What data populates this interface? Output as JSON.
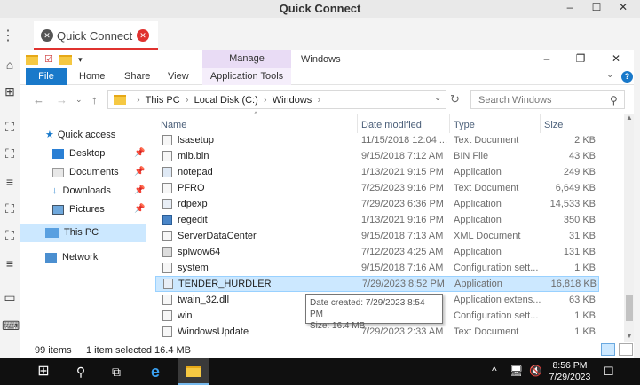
{
  "app": {
    "title": "Quick Connect",
    "tab_label": "Quick Connect",
    "window_controls": [
      "–",
      "☐",
      "✕"
    ]
  },
  "explorer": {
    "window_title": "Windows",
    "context_tab": "Manage",
    "context_subtab": "Application Tools",
    "ribbon_tabs": [
      "File",
      "Home",
      "Share",
      "View"
    ],
    "address_parts": [
      "This PC",
      "Local Disk (C:)",
      "Windows"
    ],
    "search_placeholder": "Search Windows",
    "nav_pane": {
      "quick_access": "Quick access",
      "items": [
        {
          "label": "Desktop",
          "pinned": true
        },
        {
          "label": "Documents",
          "pinned": true
        },
        {
          "label": "Downloads",
          "pinned": true
        },
        {
          "label": "Pictures",
          "pinned": true
        }
      ],
      "this_pc": "This PC",
      "network": "Network"
    },
    "columns": {
      "name": "Name",
      "date": "Date modified",
      "type": "Type",
      "size": "Size"
    },
    "files": [
      {
        "name": "lsasetup",
        "date": "11/15/2018 12:04 ...",
        "type": "Text Document",
        "size": "2 KB",
        "icon": "text-file-icon"
      },
      {
        "name": "mib.bin",
        "date": "9/15/2018 7:12 AM",
        "type": "BIN File",
        "size": "43 KB",
        "icon": "file-icon"
      },
      {
        "name": "notepad",
        "date": "1/13/2021 9:15 PM",
        "type": "Application",
        "size": "249 KB",
        "icon": "notepad-icon"
      },
      {
        "name": "PFRO",
        "date": "7/25/2023 9:16 PM",
        "type": "Text Document",
        "size": "6,649 KB",
        "icon": "text-file-icon"
      },
      {
        "name": "rdpexp",
        "date": "7/29/2023 6:36 PM",
        "type": "Application",
        "size": "14,533 KB",
        "icon": "app-icon"
      },
      {
        "name": "regedit",
        "date": "1/13/2021 9:16 PM",
        "type": "Application",
        "size": "350 KB",
        "icon": "regedit-icon"
      },
      {
        "name": "ServerDataCenter",
        "date": "9/15/2018 7:13 AM",
        "type": "XML Document",
        "size": "31 KB",
        "icon": "xml-file-icon"
      },
      {
        "name": "splwow64",
        "date": "7/12/2023 4:25 AM",
        "type": "Application",
        "size": "131 KB",
        "icon": "printer-icon"
      },
      {
        "name": "system",
        "date": "9/15/2018 7:16 AM",
        "type": "Configuration sett...",
        "size": "1 KB",
        "icon": "config-file-icon"
      },
      {
        "name": "TENDER_HURDLER",
        "date": "7/29/2023 8:52 PM",
        "type": "Application",
        "size": "16,818 KB",
        "icon": "app-icon"
      },
      {
        "name": "twain_32.dll",
        "date": "",
        "type": "Application extens...",
        "size": "63 KB",
        "icon": "dll-file-icon"
      },
      {
        "name": "win",
        "date": "",
        "type": "Configuration sett...",
        "size": "1 KB",
        "icon": "config-file-icon"
      },
      {
        "name": "WindowsUpdate",
        "date": "7/29/2023 2:33 AM",
        "type": "Text Document",
        "size": "1 KB",
        "icon": "text-file-icon"
      }
    ],
    "selected_file": "TENDER_HURDLER",
    "tooltip": {
      "date_created": "Date created: 7/29/2023 8:54 PM",
      "size": "Size: 16.4 MB"
    },
    "status": {
      "item_count": "99 items",
      "selection": "1 item selected  16.4 MB"
    }
  },
  "taskbar": {
    "time": "8:56 PM",
    "date": "7/29/2023"
  },
  "colors": {
    "accent": "#1979ca",
    "selection": "#cce8ff",
    "context_tab": "#e9dcf5",
    "close_red": "#e0322f",
    "taskbar": "#101010"
  }
}
